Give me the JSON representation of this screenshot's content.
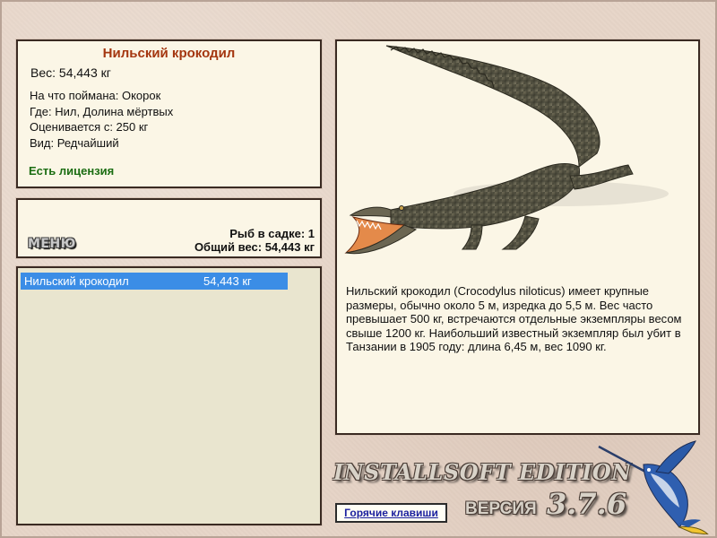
{
  "fish_info": {
    "name": "Нильский крокодил",
    "weight": "Вес: 54,443 кг",
    "caught_on": "На что поймана: Окорок",
    "location": "Где: Нил, Долина мёртвых",
    "valued_from": "Оценивается с: 250 кг",
    "rarity": "Вид: Редчайший",
    "license": "Есть лицензия"
  },
  "keepnet": {
    "menu_label": "МЕНЮ",
    "fish_count": "Рыб в садке: 1",
    "total_weight": "Общий вес: 54,443 кг"
  },
  "catch_list": [
    {
      "name": "Нильский крокодил",
      "weight": "54,443 кг"
    }
  ],
  "description": "Нильский крокодил (Crocodylus niloticus) имеет крупные размеры, обычно около 5 м, изредка до 5,5 м. Вес часто превышает 500 кг, встречаются отдельные экземпляры весом свыше 1200 кг. Наибольший известный экземпляр был убит в Танзании в 1905 году: длина 6,45 м, вес 1090 кг.",
  "branding": {
    "edition": "INSTALLSOFT EDITION",
    "version_label": "ВЕРСИЯ",
    "version_number": "3.7.6"
  },
  "hotkeys_label": "Горячие клавиши",
  "colors": {
    "title": "#a4360f",
    "license": "#1b6d12",
    "selection": "#3b8de6",
    "link": "#1a1f9e"
  },
  "icons": {
    "fish_picture": "crocodile-image",
    "logo": "marlin-icon"
  }
}
